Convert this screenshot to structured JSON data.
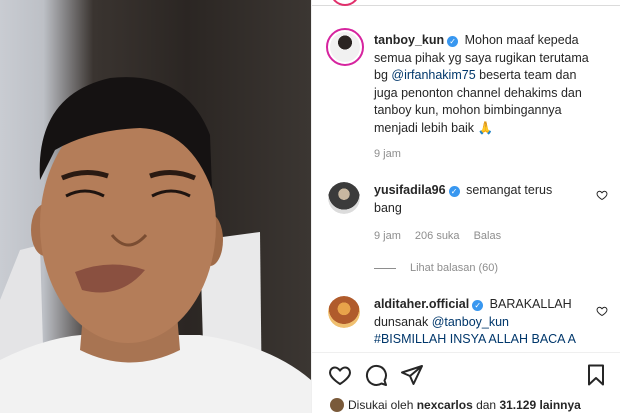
{
  "post": {
    "caption": {
      "username": "tanboy_kun",
      "lines": [
        "Mohon maaf kepeda",
        "semua pihak yg saya rugikan terutama",
        "bg ",
        "@irfanhakim75",
        " beserta team dan",
        "juga penonton channel dehakims dan",
        "tanboy kun, mohon bimbingannya",
        "menjadi lebih baik 🙏"
      ],
      "time": "9 jam"
    },
    "comments": [
      {
        "username": "yusifadila96",
        "text1": "semangat terus",
        "text2": "bang",
        "time": "9 jam",
        "likes": "206 suka",
        "reply": "Balas",
        "view_replies": "Lihat balasan (60)"
      },
      {
        "username": "alditaher.official",
        "text1": "BARAKALLAH",
        "text2": "dunsanak ",
        "mention": "@tanboy_kun",
        "text3": "#BISMILLAH INSYA ALLAH BACA A"
      }
    ],
    "liked_by": {
      "prefix": "Disukai oleh ",
      "user": "nexcarlos",
      "middle": " dan ",
      "count": "31.129 lainnya"
    }
  },
  "icons": {
    "like": "heart-icon",
    "comment": "comment-icon",
    "share": "send-icon",
    "save": "bookmark-icon",
    "verified": "verified-badge-icon"
  },
  "colors": {
    "verified": "#3897f0",
    "mention": "#00376b",
    "meta": "#8e8e8e"
  }
}
